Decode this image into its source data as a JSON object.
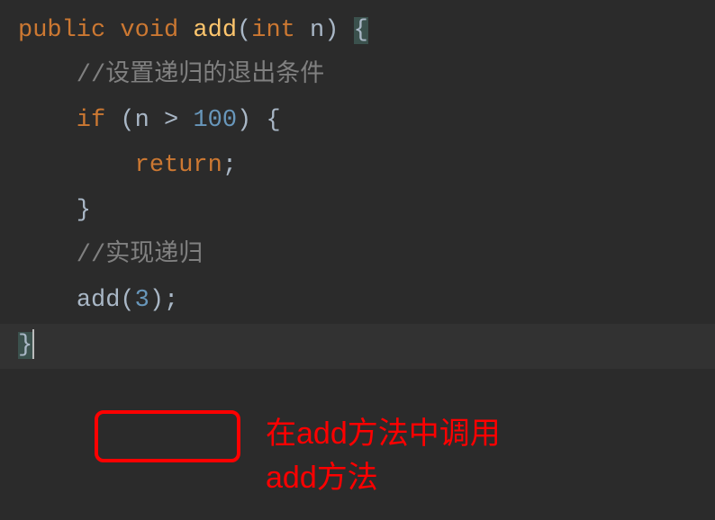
{
  "code": {
    "line1_public": "public",
    "line1_void": " void",
    "line1_method": " add",
    "line1_params": "(",
    "line1_int": "int",
    "line1_paramname": " n) ",
    "line1_brace": "{",
    "line2_comment": "    //设置递归的退出条件",
    "line3_if": "    if",
    "line3_cond": " (n > ",
    "line3_num": "100",
    "line3_end": ") {",
    "line4_return": "        return",
    "line4_semi": ";",
    "line5_close": "    }",
    "line6_blank": "",
    "line7_comment": "    //实现递归",
    "line8_indent": "    ",
    "line8_call": "add(",
    "line8_arg": "3",
    "line8_end": ");",
    "line9_brace": "}"
  },
  "annotation": {
    "text_line1": "在add方法中调用",
    "text_line2": "add方法"
  }
}
